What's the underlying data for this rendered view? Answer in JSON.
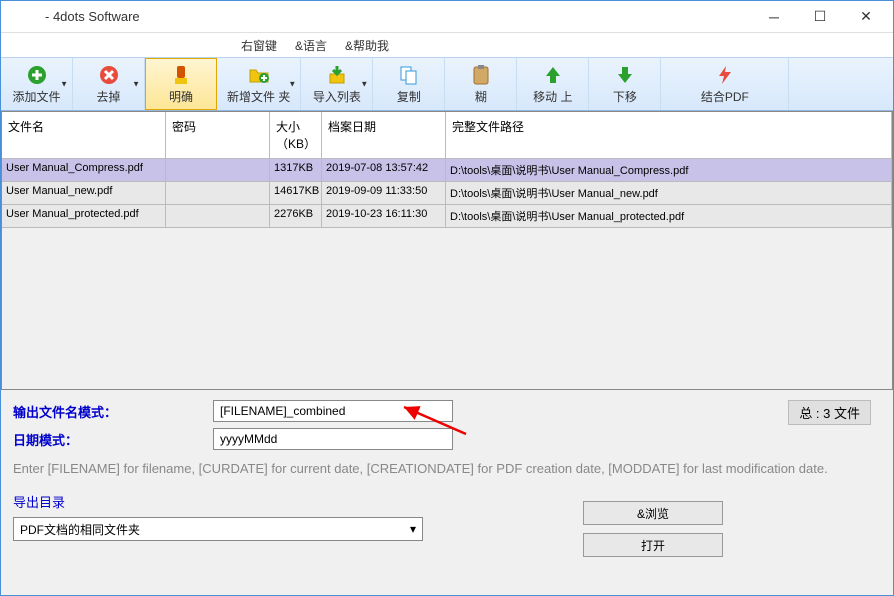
{
  "window": {
    "title": " - 4dots Software"
  },
  "menu": {
    "rightkey": "右窗键",
    "lang": "&语言",
    "help": "&帮助我"
  },
  "toolbar": {
    "add": "添加文件",
    "remove": "去掉",
    "clear": "明确",
    "newfolder": "新增文件 夹",
    "importlist": "导入列表",
    "copy": "复制",
    "paste": "糊",
    "moveup": "移动 上",
    "movedown": "下移",
    "combine": "结合PDF"
  },
  "grid": {
    "headers": {
      "name": "文件名",
      "pwd": "密码",
      "size": "大小（KB）",
      "date": "档案日期",
      "path": "完整文件路径"
    },
    "rows": [
      {
        "name": "User Manual_Compress.pdf",
        "pwd": "",
        "size": "1317KB",
        "date": "2019-07-08 13:57:42",
        "path": "D:\\tools\\桌面\\说明书\\User Manual_Compress.pdf"
      },
      {
        "name": "User Manual_new.pdf",
        "pwd": "",
        "size": "14617KB",
        "date": "2019-09-09 11:33:50",
        "path": "D:\\tools\\桌面\\说明书\\User Manual_new.pdf"
      },
      {
        "name": "User Manual_protected.pdf",
        "pwd": "",
        "size": "2276KB",
        "date": "2019-10-23 16:11:30",
        "path": "D:\\tools\\桌面\\说明书\\User Manual_protected.pdf"
      }
    ]
  },
  "form": {
    "filename_label": "输出文件名模式：",
    "filename_value": "[FILENAME]_combined",
    "date_label": "日期模式：",
    "date_value": "yyyyMMdd",
    "summary": "总 : 3 文件",
    "hint": "Enter [FILENAME] for filename, [CURDATE] for current date, [CREATIONDATE] for PDF creation date, [MODDATE] for last modification date.",
    "export_label": "导出目录",
    "export_value": "PDF文档的相同文件夹",
    "browse": "&浏览",
    "open": "打开"
  }
}
